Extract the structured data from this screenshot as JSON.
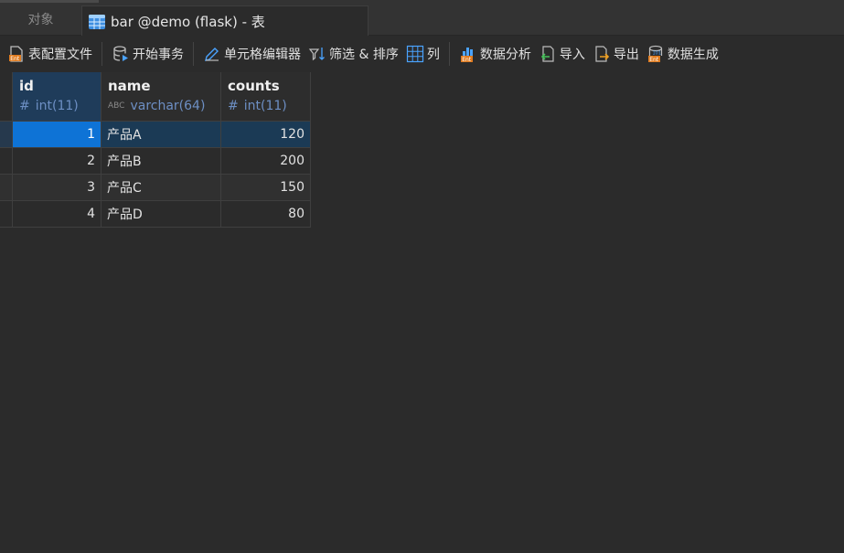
{
  "tabs": {
    "objects_label": "对象",
    "active_label": "bar @demo (flask) - 表"
  },
  "toolbar": {
    "table_config": "表配置文件",
    "begin_transaction": "开始事务",
    "cell_editor": "单元格编辑器",
    "filter_sort": "筛选 & 排序",
    "columns": "列",
    "data_analysis": "数据分析",
    "import": "导入",
    "export": "导出",
    "data_generation": "数据生成"
  },
  "icons": {
    "table_config": "table-config-icon",
    "begin_transaction": "transaction-icon",
    "cell_editor": "pencil-icon",
    "filter_sort": "filter-sort-icon",
    "columns": "columns-grid-icon",
    "data_analysis": "data-analysis-icon",
    "import": "import-icon",
    "export": "export-icon",
    "data_generation": "data-generation-icon"
  },
  "colors": {
    "accent_selected": "#0e73d6",
    "header_type_text": "#6d8fc4",
    "selected_row": "#1b3a55"
  },
  "grid": {
    "columns": [
      {
        "name": "id",
        "type": "int(11)",
        "type_glyph": "#"
      },
      {
        "name": "name",
        "type": "varchar(64)",
        "type_glyph": "ABC"
      },
      {
        "name": "counts",
        "type": "int(11)",
        "type_glyph": "#"
      }
    ],
    "rows": [
      {
        "id": "1",
        "name": "产品A",
        "counts": "120"
      },
      {
        "id": "2",
        "name": "产品B",
        "counts": "200"
      },
      {
        "id": "3",
        "name": "产品C",
        "counts": "150"
      },
      {
        "id": "4",
        "name": "产品D",
        "counts": "80"
      }
    ]
  }
}
